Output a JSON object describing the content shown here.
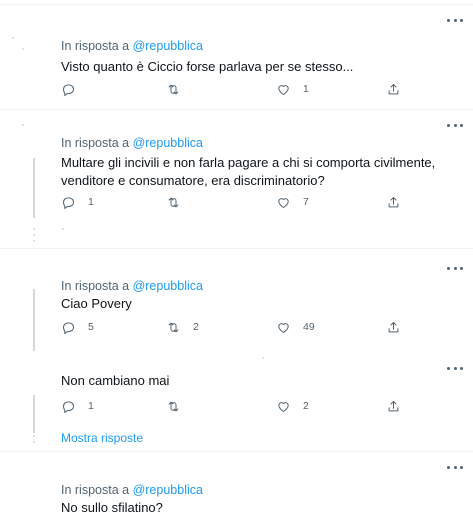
{
  "icons": {
    "reply": "reply-icon",
    "retweet": "retweet-icon",
    "like": "heart-icon",
    "share": "share-icon",
    "more": "more-icon"
  },
  "colors": {
    "link": "#1d9bf0",
    "secondary_text": "#536471",
    "divider": "#eff3f4"
  },
  "tweets": [
    {
      "reply_prefix": "In risposta a",
      "reply_handle": "@repubblica",
      "text": "Visto quanto è Ciccio forse parlava per se stesso...",
      "replies": "",
      "retweets": "",
      "likes": "1"
    },
    {
      "reply_prefix": "In risposta a",
      "reply_handle": "@repubblica",
      "text": "Multare gli incivili e non farla pagare a chi  si comporta civilmente, venditore e consumatore, era discriminatorio?",
      "replies": "1",
      "retweets": "",
      "likes": "7"
    },
    {
      "reply_prefix": "In risposta a",
      "reply_handle": "@repubblica",
      "text": "Ciao Povery",
      "replies": "5",
      "retweets": "2",
      "likes": "49"
    },
    {
      "text": "Non cambiano mai",
      "replies": "1",
      "retweets": "",
      "likes": "2",
      "show_replies": "Mostra risposte"
    },
    {
      "reply_prefix": "In risposta a",
      "reply_handle": "@repubblica",
      "text": "No sullo sfilatino?"
    }
  ]
}
